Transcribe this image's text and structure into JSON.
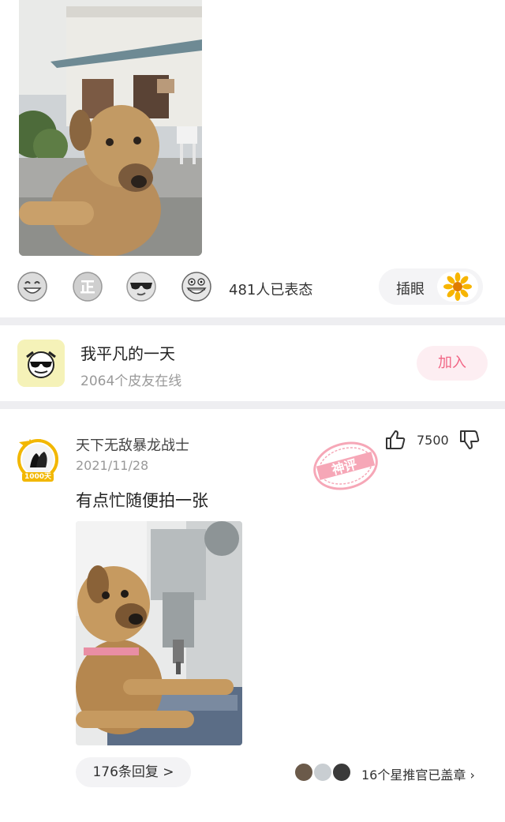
{
  "reactions": {
    "emojis": [
      "laughing-face",
      "zheng-badge",
      "sunglasses-face",
      "grinning-face"
    ],
    "count_text": "481人已表态",
    "insert_label": "插眼",
    "insert_icon": "sunflower-icon"
  },
  "group": {
    "name": "我平凡的一天",
    "online": "2064个皮友在线",
    "join_label": "加入"
  },
  "comment": {
    "username": "天下无敌暴龙战士",
    "avatar_badge": "1000天",
    "date": "2021/11/28",
    "text": "有点忙随便拍一张",
    "stamp_text": "神评",
    "likes": "7500",
    "replies_label": "176条回复 >",
    "stamp_summary": "16个星推官已盖章 ›"
  },
  "colors": {
    "accent_pink": "#f26685",
    "pink_bg": "#fdeef2",
    "divider": "#eeeef1",
    "muted": "#999999"
  }
}
